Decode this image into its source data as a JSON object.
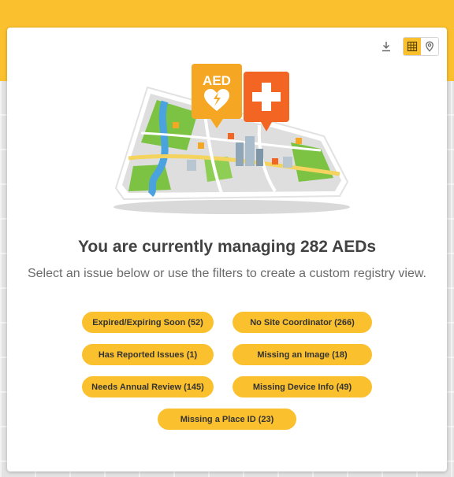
{
  "toolbar": {
    "download_icon": "download-icon",
    "grid_view_icon": "grid-view-icon",
    "map_view_icon": "map-pin-icon",
    "active_view": "grid"
  },
  "illustration": {
    "aed_badge_text": "AED",
    "colors": {
      "aed_badge": "#f5a623",
      "cross_badge": "#f26522",
      "map_green": "#7cc243",
      "map_water": "#4aa3df",
      "map_roads": "#f4d35e"
    }
  },
  "main": {
    "headline": "You are currently managing 282 AEDs",
    "subline": "Select an issue below or use the filters to create a custom registry view."
  },
  "issues": [
    {
      "label": "Expired/Expiring Soon (52)"
    },
    {
      "label": "No Site Coordinator (266)"
    },
    {
      "label": "Has Reported Issues (1)"
    },
    {
      "label": "Missing an Image (18)"
    },
    {
      "label": "Needs Annual Review (145)"
    },
    {
      "label": "Missing Device Info (49)"
    },
    {
      "label": "Missing a Place ID (23)"
    }
  ],
  "colors": {
    "accent": "#fbc02d",
    "headline": "#424242",
    "subline": "#6b6b6b"
  }
}
